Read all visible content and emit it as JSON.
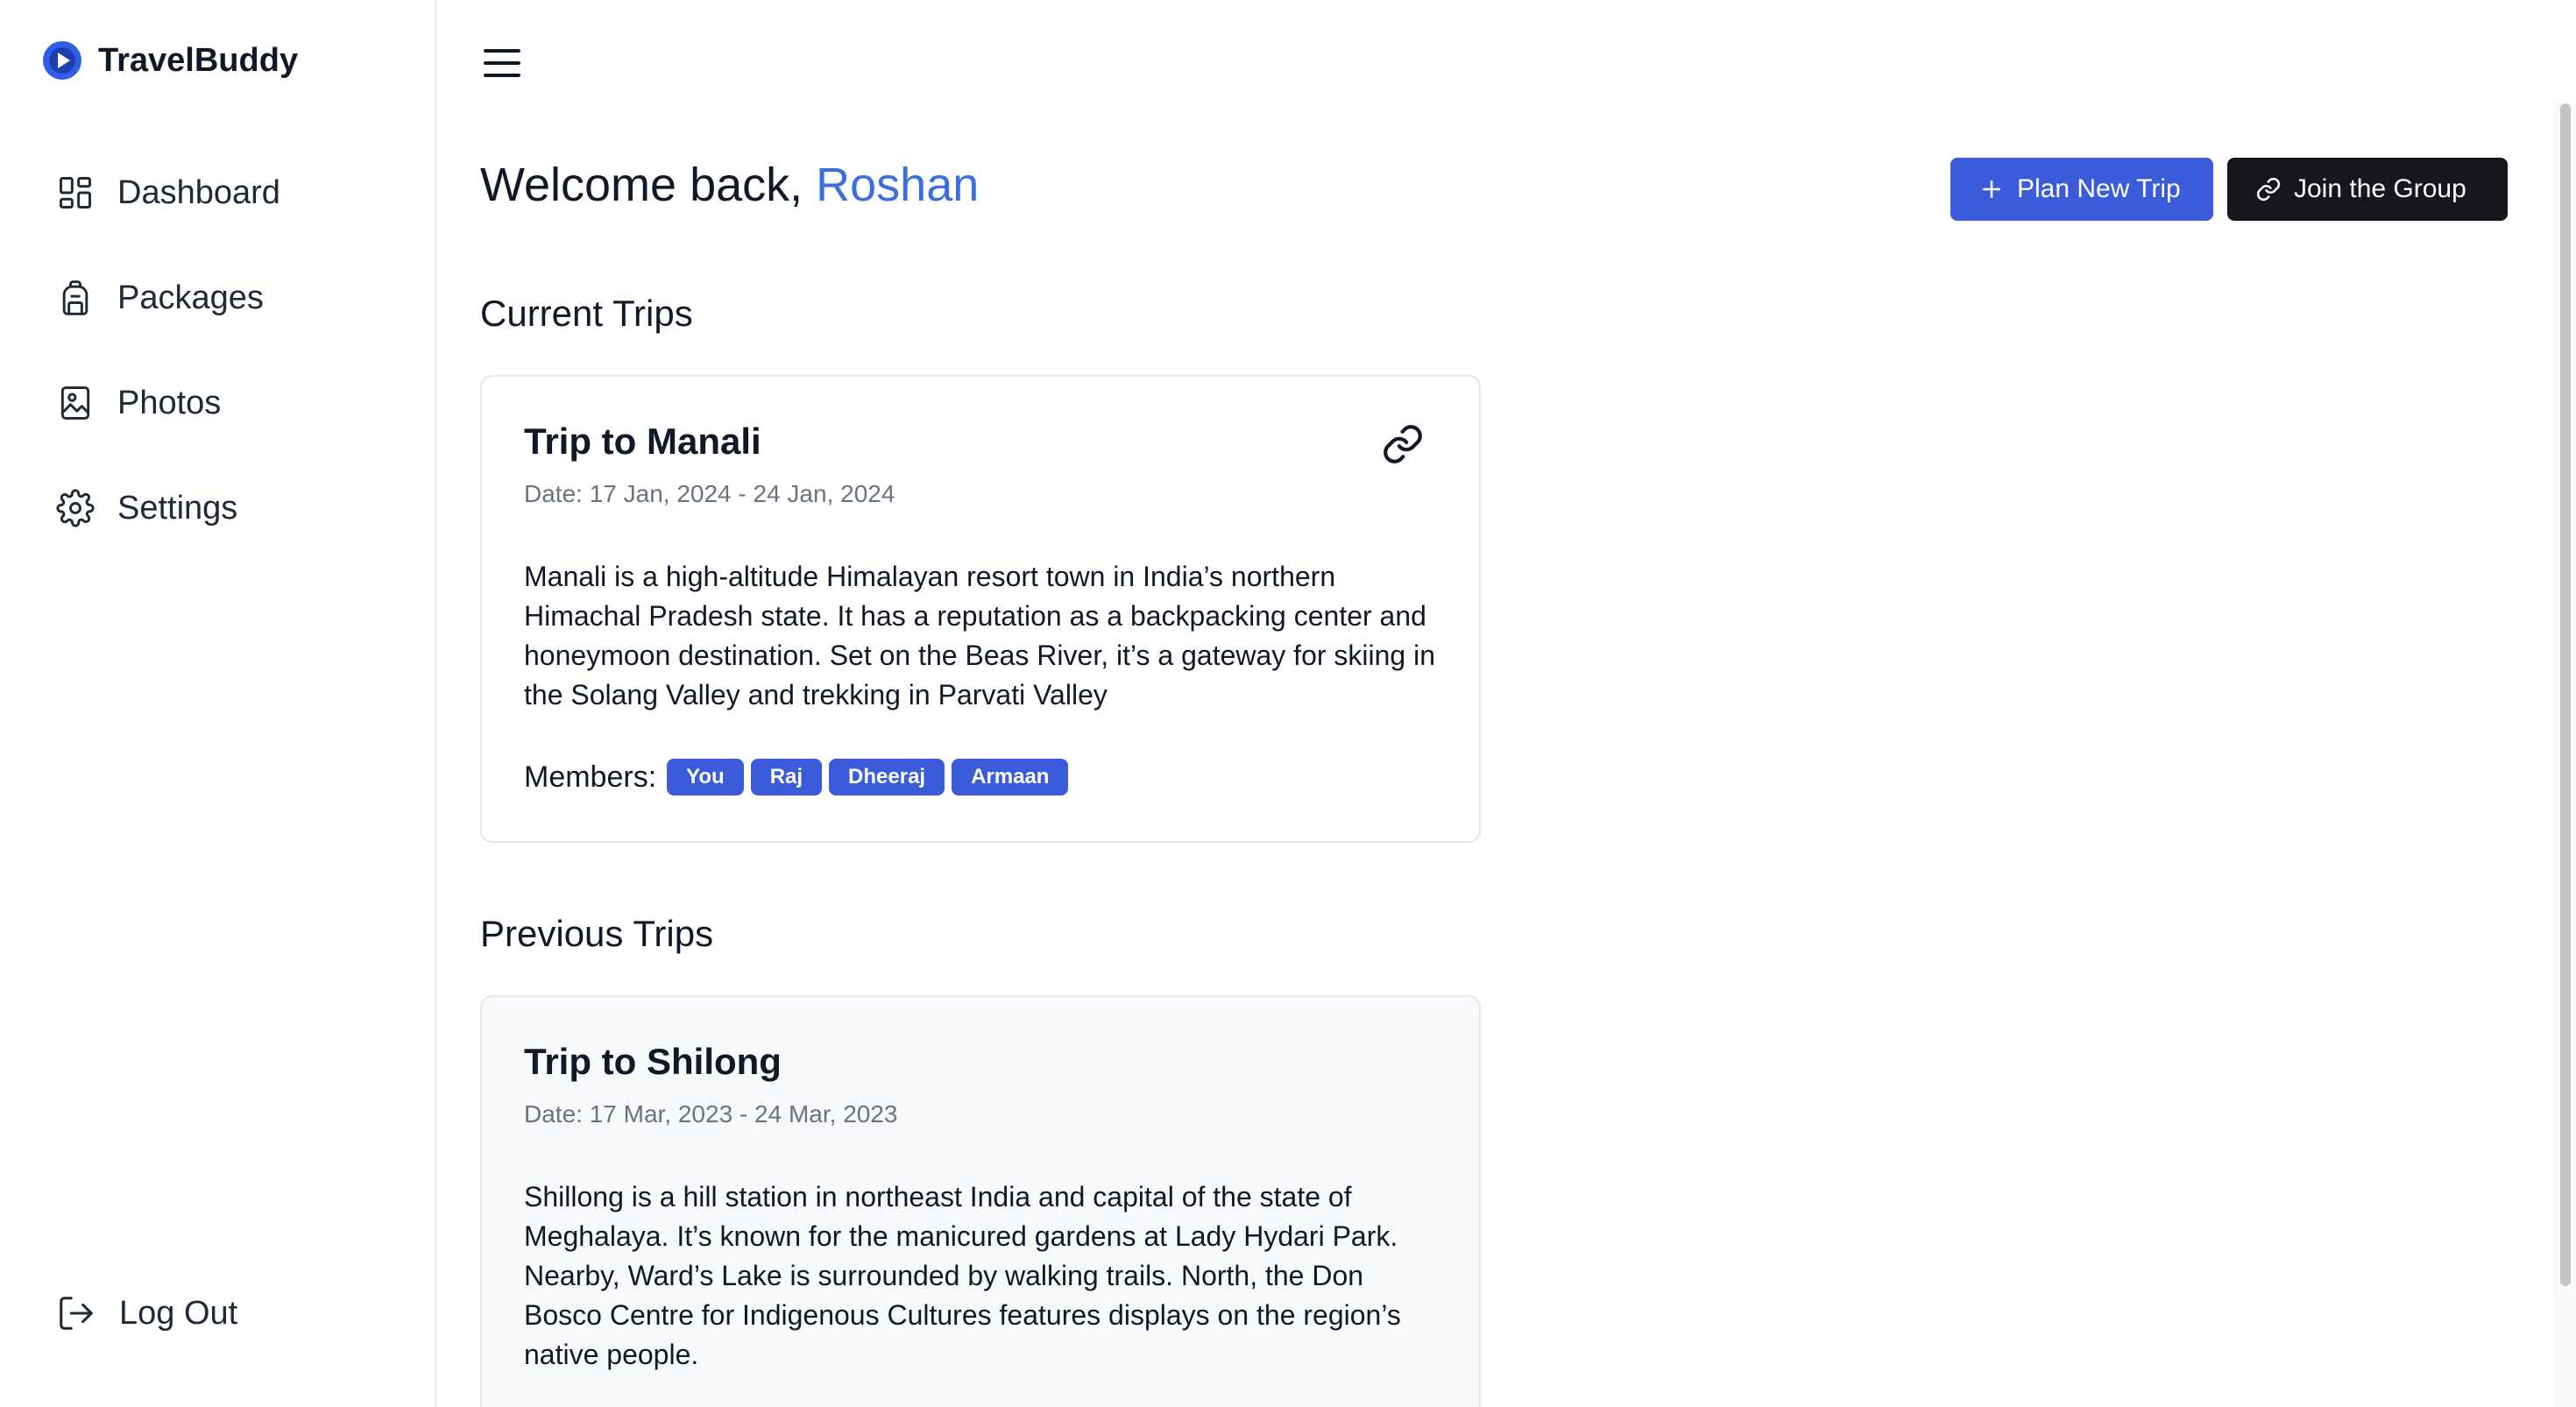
{
  "app": {
    "name": "TravelBuddy"
  },
  "sidebar": {
    "items": [
      {
        "label": "Dashboard",
        "icon": "dashboard-icon"
      },
      {
        "label": "Packages",
        "icon": "backpack-icon"
      },
      {
        "label": "Photos",
        "icon": "photo-icon"
      },
      {
        "label": "Settings",
        "icon": "gear-icon"
      }
    ],
    "logout_label": "Log Out"
  },
  "header": {
    "welcome_prefix": "Welcome back, ",
    "user_name": "Roshan",
    "plan_button": "Plan New Trip",
    "join_button": "Join the Group"
  },
  "sections": {
    "current": "Current Trips",
    "previous": "Previous Trips"
  },
  "current_trip": {
    "title": "Trip to Manali",
    "date": "Date: 17 Jan, 2024 - 24 Jan, 2024",
    "description": "Manali is a high-altitude Himalayan resort town in India’s northern Himachal Pradesh state. It has a reputation as a backpacking center and honeymoon destination. Set on the Beas River, it’s a gateway for skiing in the Solang Valley and trekking in Parvati Valley",
    "members_label": "Members:",
    "members": [
      "You",
      "Raj",
      "Dheeraj",
      "Armaan"
    ]
  },
  "previous_trip": {
    "title": "Trip to Shilong",
    "date": "Date: 17 Mar, 2023 - 24 Mar, 2023",
    "description": "Shillong is a hill station in northeast India and capital of the state of Meghalaya. It’s known for the manicured gardens at Lady Hydari Park. Nearby, Ward’s Lake is surrounded by walking trails. North, the Don Bosco Centre for Indigenous Cultures features displays on the region’s native people."
  },
  "colors": {
    "accent": "#3b5bdb",
    "name_highlight": "#3b6fe0",
    "dark_button": "#16171b"
  }
}
